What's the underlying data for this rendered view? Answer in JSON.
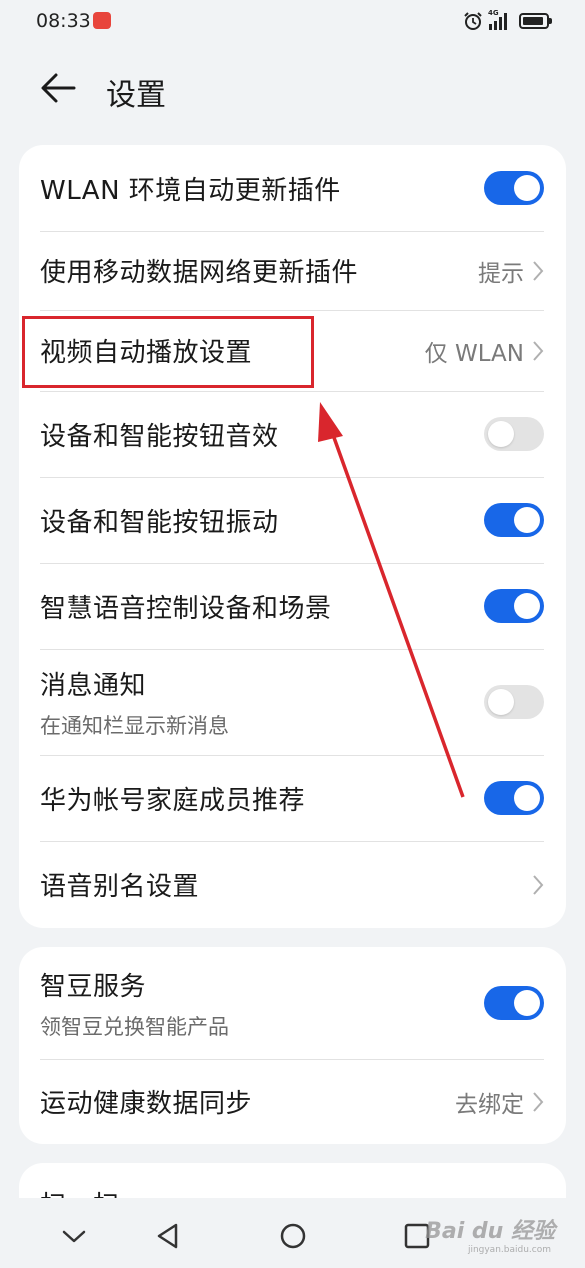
{
  "status_bar": {
    "time": "08:33",
    "network": "4G",
    "colors": {
      "app_icon": "#e8453c"
    }
  },
  "header": {
    "title": "设置",
    "back_icon": "arrow-left-icon"
  },
  "card1": {
    "rows": [
      {
        "title": "WLAN 环境自动更新插件",
        "control": "toggle",
        "on": true
      },
      {
        "title": "使用移动数据网络更新插件",
        "value": "提示",
        "control": "chevron"
      },
      {
        "title": "视频自动播放设置",
        "value": "仅 WLAN",
        "control": "chevron"
      },
      {
        "title": "设备和智能按钮音效",
        "control": "toggle",
        "on": false
      },
      {
        "title": "设备和智能按钮振动",
        "control": "toggle",
        "on": true
      },
      {
        "title": "智慧语音控制设备和场景",
        "control": "toggle",
        "on": true
      },
      {
        "title": "消息通知",
        "subtitle": "在通知栏显示新消息",
        "control": "toggle",
        "on": false
      },
      {
        "title": "华为帐号家庭成员推荐",
        "control": "toggle",
        "on": true
      },
      {
        "title": "语音别名设置",
        "control": "chevron"
      }
    ]
  },
  "card2": {
    "rows": [
      {
        "title": "智豆服务",
        "subtitle": "领智豆兑换智能产品",
        "control": "toggle",
        "on": true
      },
      {
        "title": "运动健康数据同步",
        "value": "去绑定",
        "control": "chevron"
      }
    ]
  },
  "card3": {
    "rows": [
      {
        "title": "扫一扫"
      }
    ]
  },
  "nav_bar": {
    "icons": [
      "chevron-down-icon",
      "back-triangle-icon",
      "home-circle-icon",
      "recents-square-icon"
    ]
  },
  "watermark": {
    "text": "Bai du 经验",
    "sub": "jingyan.baidu.com"
  },
  "colors": {
    "accent": "#1867e8",
    "toggle_off": "#e3e3e3",
    "annotation": "#d9262d",
    "background": "#f1f3f5"
  }
}
